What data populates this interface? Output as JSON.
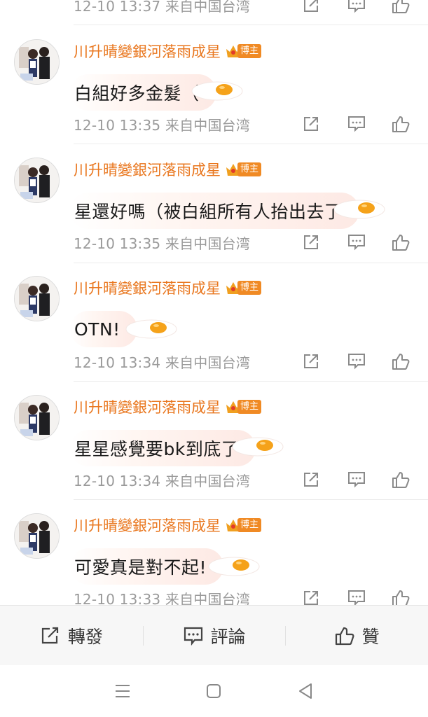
{
  "top_partial": {
    "meta": "12-10 13:37 来自中国台湾"
  },
  "comments": [
    {
      "username": "川升晴變銀河落雨成星",
      "badge": "博主",
      "text": "白組好多金髮（",
      "meta": "12-10 13:35 来自中国台湾"
    },
    {
      "username": "川升晴變銀河落雨成星",
      "badge": "博主",
      "text": "星還好嗎（被白組所有人抬出去了",
      "meta": "12-10 13:35 来自中国台湾"
    },
    {
      "username": "川升晴變銀河落雨成星",
      "badge": "博主",
      "text": "OTN!",
      "meta": "12-10 13:34 来自中国台湾"
    },
    {
      "username": "川升晴變銀河落雨成星",
      "badge": "博主",
      "text": "星星感覺要bk到底了",
      "meta": "12-10 13:34 来自中国台湾"
    },
    {
      "username": "川升晴變銀河落雨成星",
      "badge": "博主",
      "text": "可愛真是對不起!",
      "meta": "12-10 13:33 来自中国台湾"
    }
  ],
  "bottom_bar": {
    "repost": "轉發",
    "comment": "評論",
    "like": "贊"
  },
  "icons": {
    "meta": [
      "share-icon",
      "comment-icon",
      "like-icon"
    ],
    "nav": [
      "menu-icon",
      "home-icon",
      "back-icon"
    ]
  },
  "colors": {
    "username": "#e9771f",
    "badge": "#f08a24",
    "meta_text": "#9a9a9a"
  }
}
